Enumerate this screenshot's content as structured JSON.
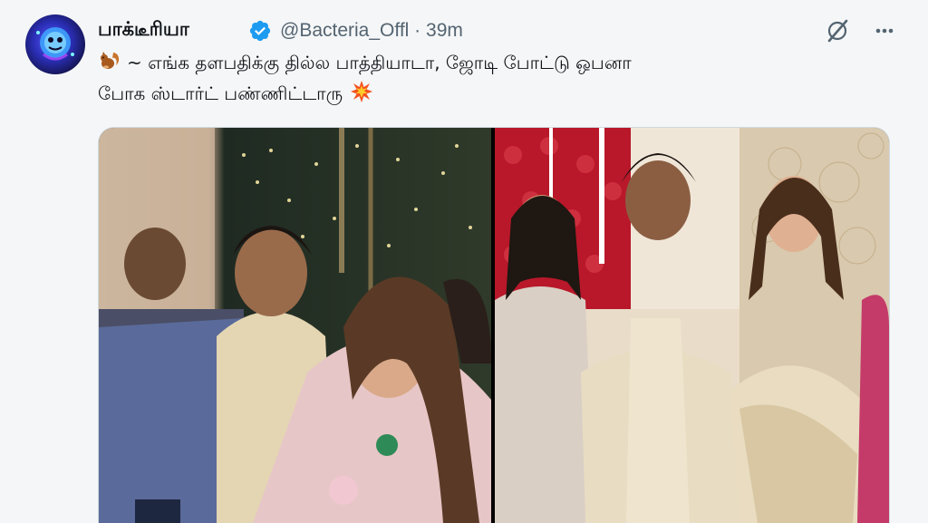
{
  "tweet": {
    "display_name": "பாக்டீரியா",
    "handle": "@Bacteria_Offl",
    "separator": "·",
    "time": "39m",
    "text_line1": "~ எங்க தளபதிக்கு தில்ல பாத்தியாடா, ஜோடி போட்டு ஒபனா",
    "text_line2": "போக ஸ்டார்ட் பண்ணிட்டாரு",
    "emoji_start": "squirrel-emoji",
    "emoji_end": "collision-emoji"
  },
  "icons": {
    "verified": "verified-badge-icon",
    "grok": "grok-icon",
    "more": "more-icon"
  },
  "colors": {
    "verified_blue": "#1d9bf0",
    "name_text": "#0f1419",
    "handle_text": "#536471"
  },
  "media": {
    "count": 2,
    "photos": [
      "photo-1",
      "photo-2"
    ]
  }
}
